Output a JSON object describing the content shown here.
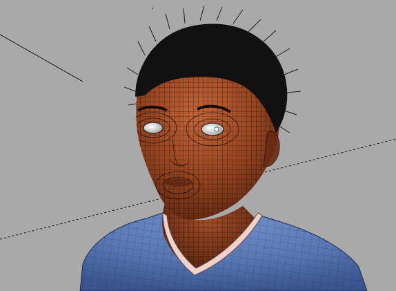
{
  "viewport": {
    "background_color": "#a9a9a9",
    "grid_line_color": "#000000",
    "wireframe_color": "#000000"
  },
  "model": {
    "skin_color": "#8a3d1e",
    "skin_highlight": "#b5572c",
    "shirt_color": "#5674b3",
    "collar_color": "#f0d4cc",
    "eye_color": "#e8e8e8",
    "hair_color": "#111111"
  }
}
